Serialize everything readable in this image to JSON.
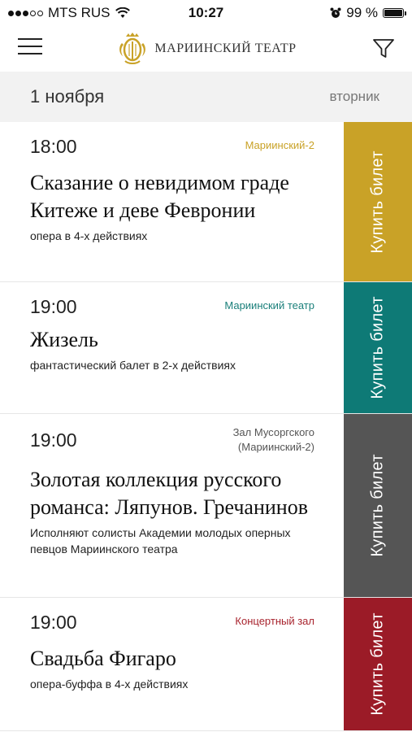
{
  "status_bar": {
    "carrier": "MTS RUS",
    "time": "10:27",
    "battery": "99 %",
    "battery_level": 0.99
  },
  "header": {
    "logo_text": "МАРИИНСКИЙ ТЕАТР"
  },
  "day": {
    "date": "1 ноября",
    "weekday": "вторник"
  },
  "buy_label": "Купить билет",
  "events": [
    {
      "time": "18:00",
      "venue": "Мариинский-2",
      "venue_color": "#c9a227",
      "title": "Сказание о невидимом граде Китеже и деве Февронии",
      "description": "опера в 4-х действиях",
      "button_color": "#c9a227"
    },
    {
      "time": "19:00",
      "venue": "Мариинский театр",
      "venue_color": "#1a7f7a",
      "title": "Жизель",
      "description": "фантастический балет в 2-х действиях",
      "button_color": "#0e7a76"
    },
    {
      "time": "19:00",
      "venue": "Зал Мусоргского (Мариинский-2)",
      "venue_color": "#555555",
      "title": "Золотая коллекция русского романса: Ляпунов. Гречанинов",
      "description": "Исполняют солисты Академии молодых оперных певцов Мариинского театра",
      "button_color": "#555555"
    },
    {
      "time": "19:00",
      "venue": "Концертный зал",
      "venue_color": "#a8242e",
      "title": "Свадьба Фигаро",
      "description": "опера-буффа в 4-х действиях",
      "button_color": "#9b1b27"
    }
  ]
}
